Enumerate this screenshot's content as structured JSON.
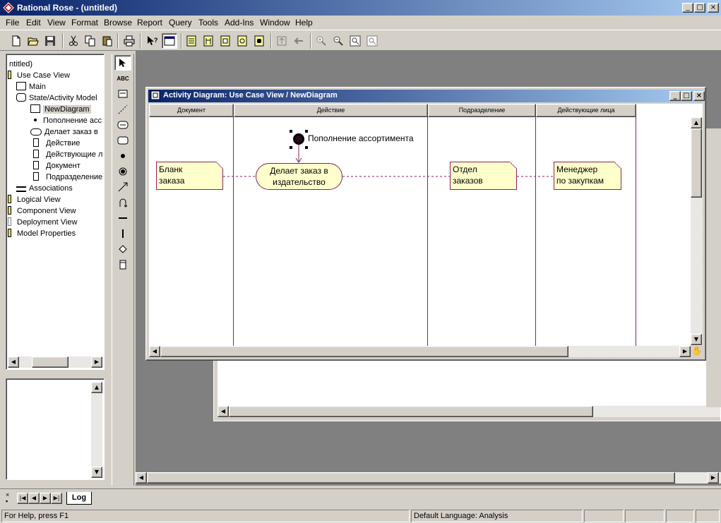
{
  "app": {
    "title": "Rational Rose - (untitled)",
    "accent": "#0a246a"
  },
  "window_controls": {
    "minimize": "_",
    "maximize": "□",
    "close": "×"
  },
  "menu": [
    "File",
    "Edit",
    "View",
    "Format",
    "Browse",
    "Report",
    "Query",
    "Tools",
    "Add-Ins",
    "Window",
    "Help"
  ],
  "toolbar": {
    "icons": [
      "new-icon",
      "open-icon",
      "save-icon",
      "cut-icon",
      "copy-icon",
      "paste-icon",
      "print-icon",
      "context-help-icon",
      "view-doc-icon",
      "class-diagram-icon",
      "interaction-diagram-icon",
      "component-diagram-icon",
      "deployment-diagram-icon",
      "state-diagram-icon",
      "browse-parent-icon",
      "browse-previous-icon",
      "zoom-in-icon",
      "zoom-out-icon",
      "fit-window-icon",
      "undo-fit-icon"
    ]
  },
  "tree": {
    "items": [
      {
        "label": "ntitled)",
        "icon": ""
      },
      {
        "label": "Use Case View",
        "icon": "folder-icon"
      },
      {
        "label": "Main",
        "icon": "diagram-icon"
      },
      {
        "label": "State/Activity Model",
        "icon": "state-model-icon"
      },
      {
        "label": "NewDiagram",
        "icon": "activity-diagram-icon"
      },
      {
        "label": "Пополнение асс",
        "icon": "start-state-icon"
      },
      {
        "label": "Делает заказ в",
        "icon": "activity-icon"
      },
      {
        "label": "Действие",
        "icon": "swimlane-icon"
      },
      {
        "label": "Действующие л",
        "icon": "swimlane-icon"
      },
      {
        "label": "Документ",
        "icon": "swimlane-icon"
      },
      {
        "label": "Подразделение",
        "icon": "swimlane-icon"
      },
      {
        "label": "Associations",
        "icon": "associations-icon"
      },
      {
        "label": "Logical View",
        "icon": "folder-icon"
      },
      {
        "label": "Component View",
        "icon": "folder-icon"
      },
      {
        "label": "Deployment View",
        "icon": "folder-icon"
      },
      {
        "label": "Model Properties",
        "icon": "folder-icon"
      }
    ]
  },
  "toolbox": {
    "tools": [
      "select-tool-icon",
      "text-tool-icon",
      "note-tool-icon",
      "anchor-note-icon",
      "activity-tool-icon",
      "state-tool-icon",
      "start-state-icon",
      "end-state-icon",
      "transition-icon",
      "self-transition-icon",
      "horizontal-sync-icon",
      "vertical-sync-icon",
      "decision-icon",
      "swimlane-icon"
    ],
    "text_tool_label": "ABC"
  },
  "diagram": {
    "title": "Activity Diagram: Use Case View / NewDiagram",
    "swimlanes": [
      "Документ",
      "Действие",
      "Подразделение",
      "Действующие лица"
    ],
    "start_state_label": "Пополнение ассортимента",
    "activity": {
      "line1": "Делает заказ в",
      "line2": "издательство"
    },
    "notes": [
      {
        "line1": "Бланк",
        "line2": "заказа"
      },
      {
        "line1": "Отдел",
        "line2": "заказов"
      },
      {
        "line1": "Менеджер",
        "line2": "по закупкам"
      }
    ],
    "line_color": "#8b2060",
    "note_fill": "#ffffcc"
  },
  "log_tab": {
    "label": "Log"
  },
  "status": {
    "help": "For Help, press F1",
    "language": "Default Language: Analysis"
  }
}
